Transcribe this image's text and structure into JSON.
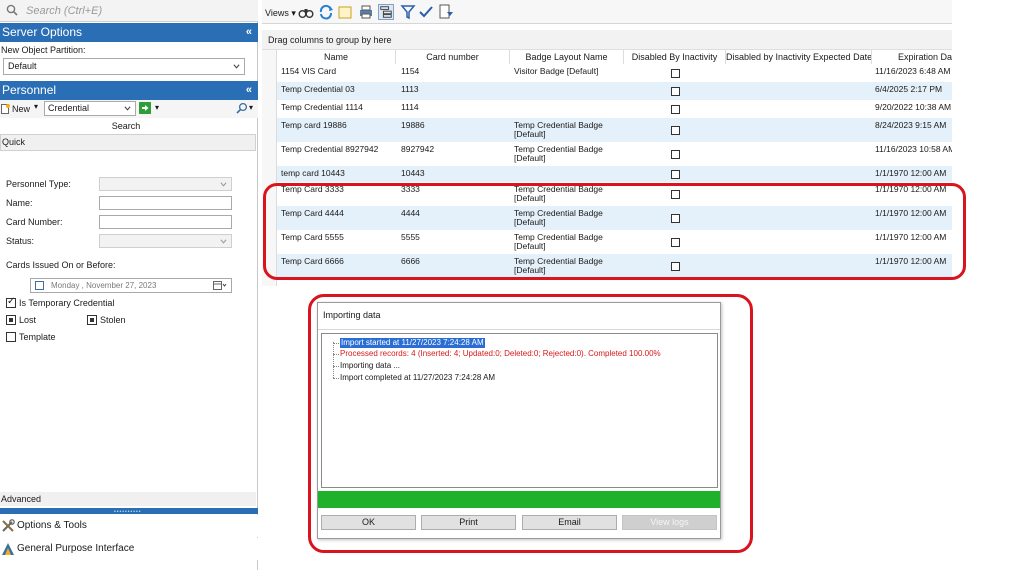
{
  "search": {
    "placeholder": "Search (Ctrl+E)"
  },
  "server_options": {
    "title": "Server Options",
    "partition_label": "New Object Partition:",
    "partition_value": "Default"
  },
  "personnel": {
    "title": "Personnel",
    "new_label": "New",
    "type_value": "Credential",
    "search_label": "Search",
    "quick_tab": "Quick",
    "fields": {
      "personnel_type": "Personnel Type:",
      "name": "Name:",
      "card_number": "Card Number:",
      "status": "Status:",
      "issued_before": "Cards Issued On or Before:",
      "date_value": "Monday   , November 27, 2023"
    },
    "checks": {
      "temp": "Is Temporary Credential",
      "lost": "Lost",
      "stolen": "Stolen",
      "template": "Template"
    },
    "advanced": "Advanced"
  },
  "nav": {
    "options_tools": "Options & Tools",
    "gpi": "General Purpose Interface"
  },
  "toolbar": {
    "views": "Views"
  },
  "grid": {
    "group_hint": "Drag columns to group by here",
    "headers": {
      "name": "Name",
      "card": "Card number",
      "badge": "Badge Layout Name",
      "disabled": "Disabled By Inactivity",
      "expected": "Disabled by Inactivity Expected Date",
      "expiration": "Expiration Date"
    },
    "rows": [
      {
        "name": "1154 VIS Card",
        "card": "1154",
        "badge": "Visitor Badge [Default]",
        "expiration": "11/16/2023 6:48 AM"
      },
      {
        "name": "Temp Credential 03",
        "card": "1113",
        "badge": "",
        "expiration": "6/4/2025 2:17 PM"
      },
      {
        "name": "Temp Credential 1114",
        "card": "1114",
        "badge": "",
        "expiration": "9/20/2022 10:38 AM"
      },
      {
        "name": "Temp card 19886",
        "card": "19886",
        "badge": "Temp Credential Badge [Default]",
        "expiration": "8/24/2023 9:15 AM"
      },
      {
        "name": "Temp Credential 8927942",
        "card": "8927942",
        "badge": "Temp Credential Badge [Default]",
        "expiration": "11/16/2023 10:58 AM"
      },
      {
        "name": "temp card 10443",
        "card": "10443",
        "badge": "",
        "expiration": "1/1/1970 12:00 AM"
      },
      {
        "name": "Temp Card 3333",
        "card": "3333",
        "badge": "Temp Credential Badge [Default]",
        "expiration": "1/1/1970 12:00 AM"
      },
      {
        "name": "Temp Card  4444",
        "card": "4444",
        "badge": "Temp Credential Badge [Default]",
        "expiration": "1/1/1970 12:00 AM"
      },
      {
        "name": "Temp Card 5555",
        "card": "5555",
        "badge": "Temp Credential Badge [Default]",
        "expiration": "1/1/1970 12:00 AM"
      },
      {
        "name": "Temp Card 6666",
        "card": "6666",
        "badge": "Temp Credential Badge [Default]",
        "expiration": "1/1/1970 12:00 AM"
      }
    ]
  },
  "dialog": {
    "title": "Importing data",
    "log": [
      "Import started at 11/27/2023 7:24:28 AM",
      "Processed records: 4 (Inserted: 4; Updated:0; Deleted:0; Rejected:0). Completed 100.00%",
      "Importing data ...",
      "Import completed at 11/27/2023 7:24:28 AM"
    ],
    "progress": 1.0,
    "buttons": {
      "ok": "OK",
      "print": "Print",
      "email": "Email",
      "view_logs": "View logs"
    }
  },
  "colors": {
    "accent": "#2a6fb5",
    "alt_row": "#e5f1fa",
    "highlight": "#d9141e",
    "progress": "#1fb12a"
  }
}
